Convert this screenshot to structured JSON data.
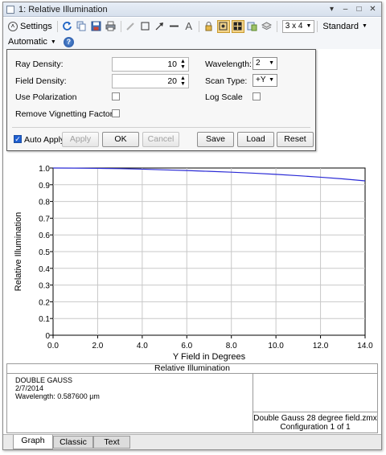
{
  "window": {
    "title": "1: Relative Illumination",
    "controls": {
      "pin": "▾",
      "minimize": "–",
      "maximize": "□",
      "close": "✕"
    }
  },
  "toolbar": {
    "settings_label": "Settings",
    "layout_value": "3 x 4",
    "standard_label": "Standard",
    "automatic_label": "Automatic",
    "icons": [
      "refresh-icon",
      "copy-icon",
      "save-icon",
      "print-icon",
      "pencil-icon",
      "rectangle-icon",
      "arrow-icon",
      "line-icon",
      "text-icon",
      "lock-icon",
      "bullseye-icon",
      "grid-icon",
      "export-icon",
      "layers-icon",
      "help-icon"
    ]
  },
  "settings": {
    "ray_density_label": "Ray Density:",
    "ray_density_value": "10",
    "field_density_label": "Field Density:",
    "field_density_value": "20",
    "use_polarization_label": "Use Polarization",
    "use_polarization_checked": false,
    "remove_vignetting_label": "Remove Vignetting Factors",
    "remove_vignetting_checked": false,
    "wavelength_label": "Wavelength:",
    "wavelength_value": "2",
    "scan_type_label": "Scan Type:",
    "scan_type_value": "+Y",
    "log_scale_label": "Log Scale",
    "log_scale_checked": false,
    "auto_apply_label": "Auto Apply",
    "auto_apply_checked": true,
    "apply_label": "Apply",
    "ok_label": "OK",
    "cancel_label": "Cancel",
    "save_label": "Save",
    "load_label": "Load",
    "reset_label": "Reset"
  },
  "chart_data": {
    "type": "line",
    "title": "",
    "xlabel": "Y Field in Degrees",
    "ylabel": "Relative Illumination",
    "xlim": [
      0,
      14
    ],
    "ylim": [
      0,
      1
    ],
    "xticks": [
      "0.0",
      "2.0",
      "4.0",
      "6.0",
      "8.0",
      "10.0",
      "12.0",
      "14.0"
    ],
    "yticks": [
      "0",
      "0.1",
      "0.2",
      "0.3",
      "0.4",
      "0.5",
      "0.6",
      "0.7",
      "0.8",
      "0.9",
      "1.0"
    ],
    "grid": true,
    "line_color": "#2a2ad6",
    "series": [
      {
        "x": [
          0,
          1,
          2,
          3,
          4,
          5,
          6,
          7,
          8,
          9,
          10,
          11,
          12,
          13,
          14
        ],
        "y": [
          1.0,
          0.9995,
          0.998,
          0.996,
          0.993,
          0.989,
          0.985,
          0.98,
          0.975,
          0.969,
          0.962,
          0.954,
          0.945,
          0.935,
          0.923
        ]
      }
    ]
  },
  "info": {
    "panel_title": "Relative Illumination",
    "lens_name": "DOUBLE GAUSS",
    "date": "2/7/2014",
    "wavelength_text": "Wavelength: 0.587600 µm",
    "file_name": "Double Gauss 28 degree field.zmx",
    "configuration": "Configuration 1 of 1"
  },
  "tabs": [
    {
      "label": "Graph",
      "active": true
    },
    {
      "label": "Classic",
      "active": false
    },
    {
      "label": "Text",
      "active": false
    }
  ]
}
